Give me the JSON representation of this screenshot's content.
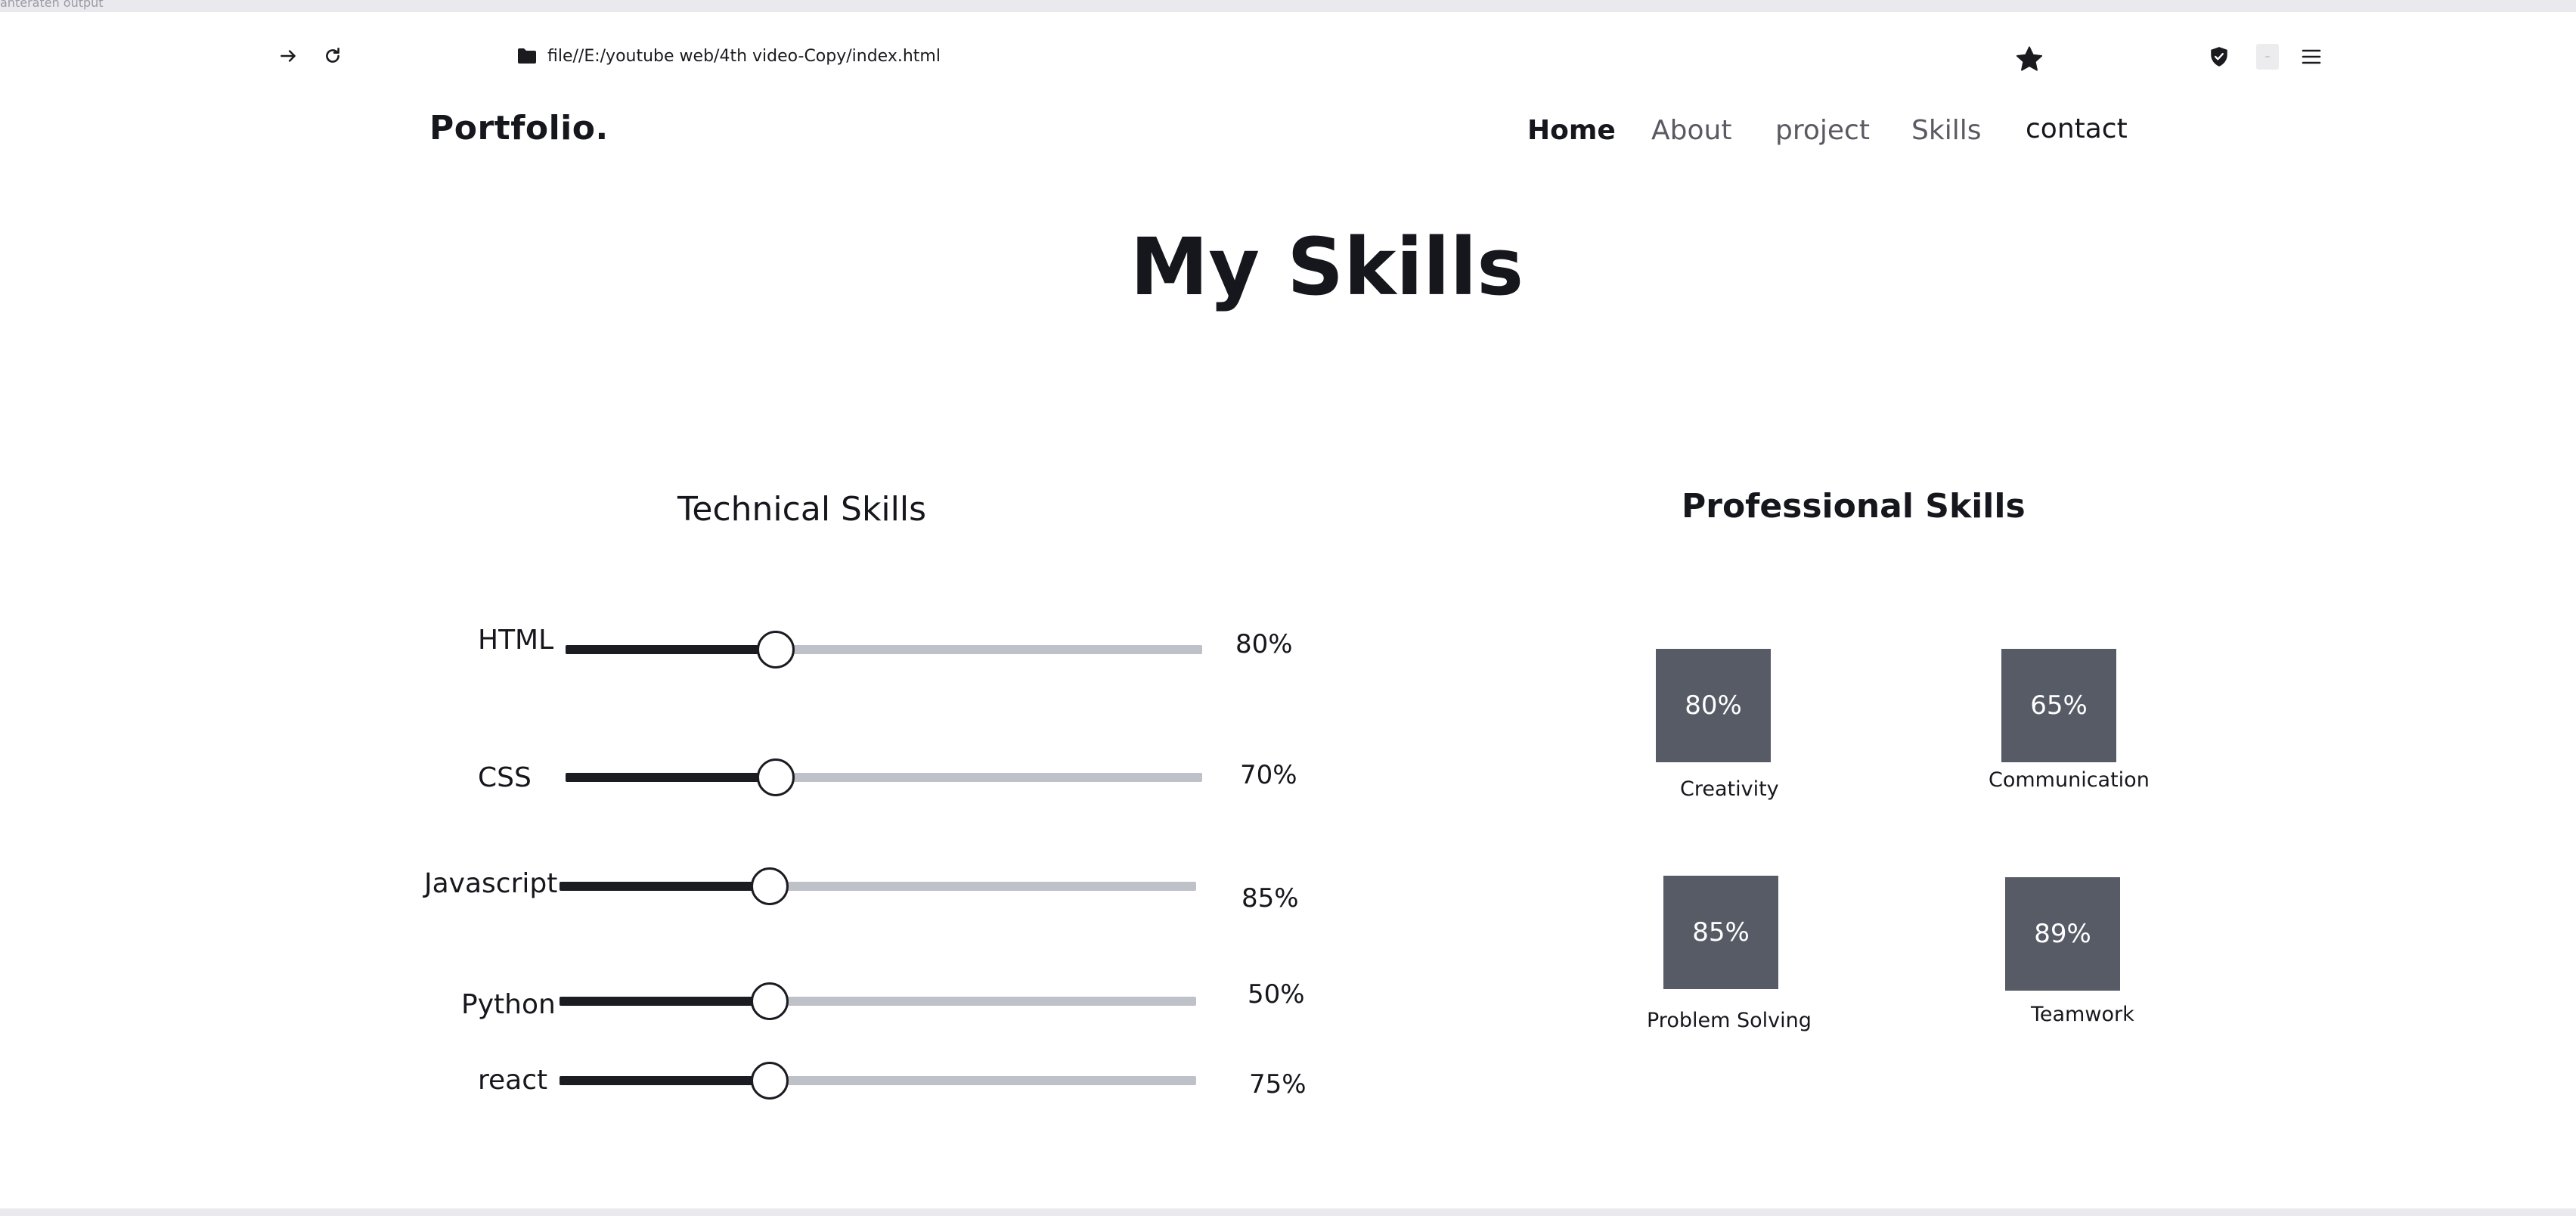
{
  "browser": {
    "top_caption": "ahteraten output",
    "url": "file//E:/youtube web/4th video-Copy/index.html",
    "icons": {
      "forward": "arrow-right-icon",
      "reload": "reload-icon",
      "folder": "folder-icon",
      "bookmark": "star-icon",
      "shield": "shield-icon",
      "extension": "extension-icon",
      "menu": "hamburger-menu-icon"
    }
  },
  "site": {
    "logo": "Portfolio.",
    "nav": [
      {
        "label": "Home"
      },
      {
        "label": "About"
      },
      {
        "label": "project"
      },
      {
        "label": "Skills"
      },
      {
        "label": "contact"
      }
    ],
    "title": "My Skills"
  },
  "technical": {
    "title": "Technical Skills",
    "skills": [
      {
        "name": "HTML",
        "pct_label": "80%",
        "slider_value": 0.33
      },
      {
        "name": "CSS",
        "pct_label": "70%",
        "slider_value": 0.33
      },
      {
        "name": "Javascript",
        "pct_label": "85%",
        "slider_value": 0.33
      },
      {
        "name": "Python",
        "pct_label": "50%",
        "slider_value": 0.33
      },
      {
        "name": "react",
        "pct_label": "75%",
        "slider_value": 0.33
      }
    ]
  },
  "professional": {
    "title": "Professional Skills",
    "skills": [
      {
        "value": "80%",
        "label": "Creativity"
      },
      {
        "value": "65%",
        "label": "Communication"
      },
      {
        "value": "85%",
        "label": "Problem Solving"
      },
      {
        "value": "89%",
        "label": "Teamwork"
      }
    ]
  },
  "colors": {
    "box": "#575b66",
    "track_fill": "#1b1b22",
    "track_rest": "#bfc1c8",
    "nav_muted": "#5a5a63"
  }
}
